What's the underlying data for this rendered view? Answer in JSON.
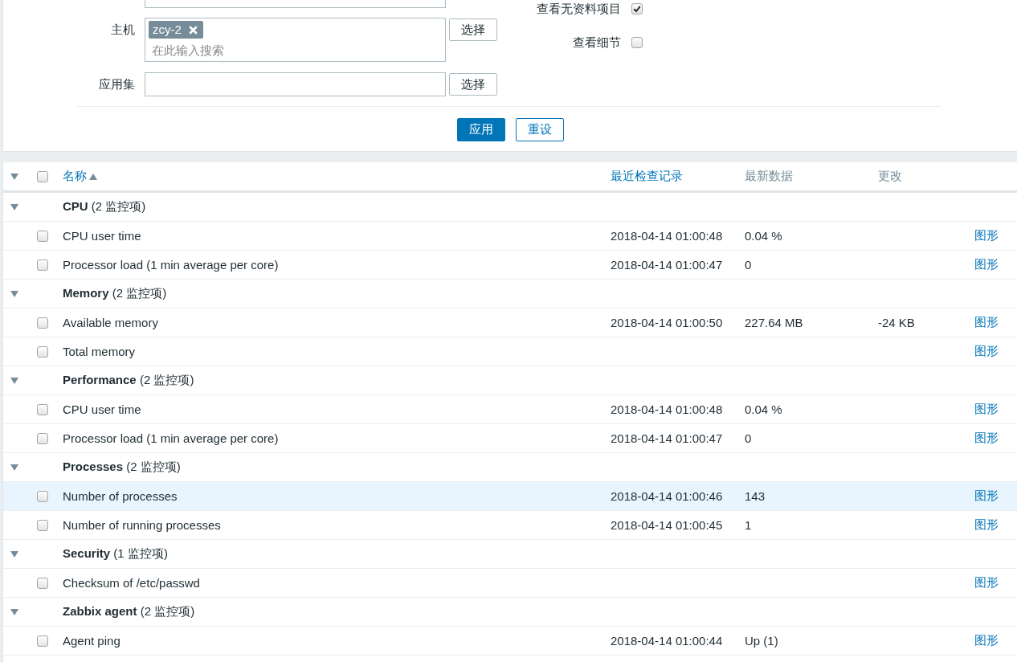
{
  "filter": {
    "fields": [
      {
        "kind": "partial"
      },
      {
        "kind": "multiselect",
        "label": "主机",
        "tags": [
          {
            "label": "zcy-2"
          }
        ],
        "placeholder": "在此输入搜索",
        "button": "选择"
      },
      {
        "kind": "text",
        "label": "应用集",
        "button": "选择"
      }
    ],
    "options": [
      {
        "label": "查看无资料项目",
        "checked": true
      },
      {
        "label": "查看细节",
        "checked": false
      }
    ],
    "actions": [
      {
        "label": "应用",
        "kind": "primary"
      },
      {
        "label": "重设",
        "kind": "secondary"
      }
    ]
  },
  "table": {
    "header": {
      "expanded": true,
      "checked": false
    },
    "columns": [
      {
        "label": "名称",
        "sortable": true,
        "sorted": true
      },
      {
        "label": "最近检查记录",
        "sortable": true,
        "sorted": false
      },
      {
        "label": "最新数据",
        "sortable": false,
        "sorted": false
      },
      {
        "label": "更改",
        "sortable": false,
        "sorted": false
      }
    ],
    "groups": [
      {
        "title": "**CPU** (2 监控项)",
        "expanded": true,
        "items": [
          {
            "name": "CPU user time",
            "checked": false,
            "highlighted": false,
            "last_check": "2018-04-14 01:00:48",
            "latest": "0.04 %",
            "action_link": "图形"
          },
          {
            "name": "Processor load (1 min average per core)",
            "checked": false,
            "highlighted": false,
            "last_check": "2018-04-14 01:00:47",
            "latest": "0",
            "action_link": "图形"
          }
        ]
      },
      {
        "title": "**Memory** (2 监控项)",
        "expanded": true,
        "items": [
          {
            "name": "Available memory",
            "checked": false,
            "highlighted": false,
            "last_check": "2018-04-14 01:00:50",
            "latest": "227.64 MB",
            "change": "-24 KB",
            "action_link": "图形"
          },
          {
            "name": "Total memory",
            "checked": false,
            "highlighted": false,
            "action_link": "图形"
          }
        ]
      },
      {
        "title": "**Performance** (2 监控项)",
        "expanded": true,
        "items": [
          {
            "name": "CPU user time",
            "checked": false,
            "highlighted": false,
            "last_check": "2018-04-14 01:00:48",
            "latest": "0.04 %",
            "action_link": "图形"
          },
          {
            "name": "Processor load (1 min average per core)",
            "checked": false,
            "highlighted": false,
            "last_check": "2018-04-14 01:00:47",
            "latest": "0",
            "action_link": "图形"
          }
        ]
      },
      {
        "title": "**Processes** (2 监控项)",
        "expanded": true,
        "items": [
          {
            "name": "Number of processes",
            "checked": false,
            "highlighted": true,
            "last_check": "2018-04-14 01:00:46",
            "latest": "143",
            "action_link": "图形"
          },
          {
            "name": "Number of running processes",
            "checked": false,
            "highlighted": false,
            "last_check": "2018-04-14 01:00:45",
            "latest": "1",
            "action_link": "图形"
          }
        ]
      },
      {
        "title": "**Security** (1 监控项)",
        "expanded": true,
        "items": [
          {
            "name": "Checksum of /etc/passwd",
            "checked": false,
            "highlighted": false,
            "action_link": "图形"
          }
        ]
      },
      {
        "title": "**Zabbix agent** (2 监控项)",
        "expanded": true,
        "items": [
          {
            "name": "Agent ping",
            "checked": false,
            "highlighted": false,
            "last_check": "2018-04-14 01:00:44",
            "latest": "Up (1)",
            "action_link": "图形"
          }
        ]
      }
    ]
  }
}
